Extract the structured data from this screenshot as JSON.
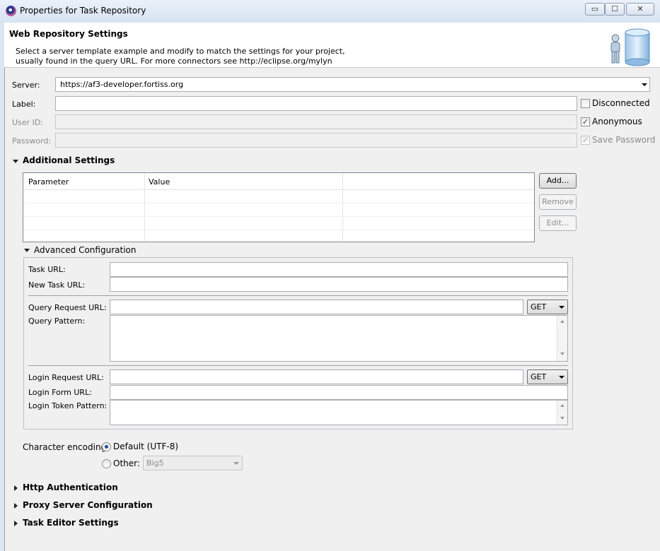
{
  "window": {
    "title": "Properties for Task Repository",
    "minimize_label": "▭",
    "maximize_label": "☐",
    "close_label": "✕"
  },
  "header": {
    "title": "Web Repository Settings",
    "description_line1": "Select a server template example and modify to match the settings for your project,",
    "description_line2": "usually found in the query URL.  For more connectors see http://eclipse.org/mylyn",
    "banner_icon": "user-database-icon"
  },
  "form": {
    "server_label": "Server:",
    "server_value": "https://af3-developer.fortiss.org",
    "label_label": "Label:",
    "label_value": "",
    "userid_label": "User ID:",
    "userid_value": "",
    "password_label": "Password:",
    "password_value": "",
    "disconnected_label": "Disconnected",
    "disconnected_checked": false,
    "anonymous_label": "Anonymous",
    "anonymous_checked": true,
    "save_password_label": "Save Password",
    "save_password_checked": true
  },
  "additional_settings": {
    "title": "Additional Settings",
    "columns": [
      "Parameter",
      "Value",
      ""
    ],
    "rows": [],
    "add_label": "Add...",
    "remove_label": "Remove",
    "edit_label": "Edit..."
  },
  "advanced": {
    "title": "Advanced Configuration",
    "task_url_label": "Task URL:",
    "task_url_value": "",
    "new_task_url_label": "New Task URL:",
    "new_task_url_value": "",
    "query_request_url_label": "Query Request URL:",
    "query_request_url_value": "",
    "query_method": "GET",
    "query_pattern_label": "Query Pattern:",
    "query_pattern_value": "",
    "login_request_url_label": "Login Request URL:",
    "login_request_url_value": "",
    "login_method": "GET",
    "login_form_url_label": "Login Form URL:",
    "login_form_url_value": "",
    "login_token_pattern_label": "Login Token Pattern:",
    "login_token_pattern_value": ""
  },
  "encoding": {
    "label": "Character encoding:",
    "default_label": "Default (UTF-8)",
    "default_selected": true,
    "other_label": "Other:",
    "other_value": "Big5"
  },
  "sections": {
    "http_auth": "Http Authentication",
    "proxy": "Proxy Server Configuration",
    "task_editor": "Task Editor Settings"
  },
  "colors": {
    "selection_accent": "#1e4d9b"
  }
}
